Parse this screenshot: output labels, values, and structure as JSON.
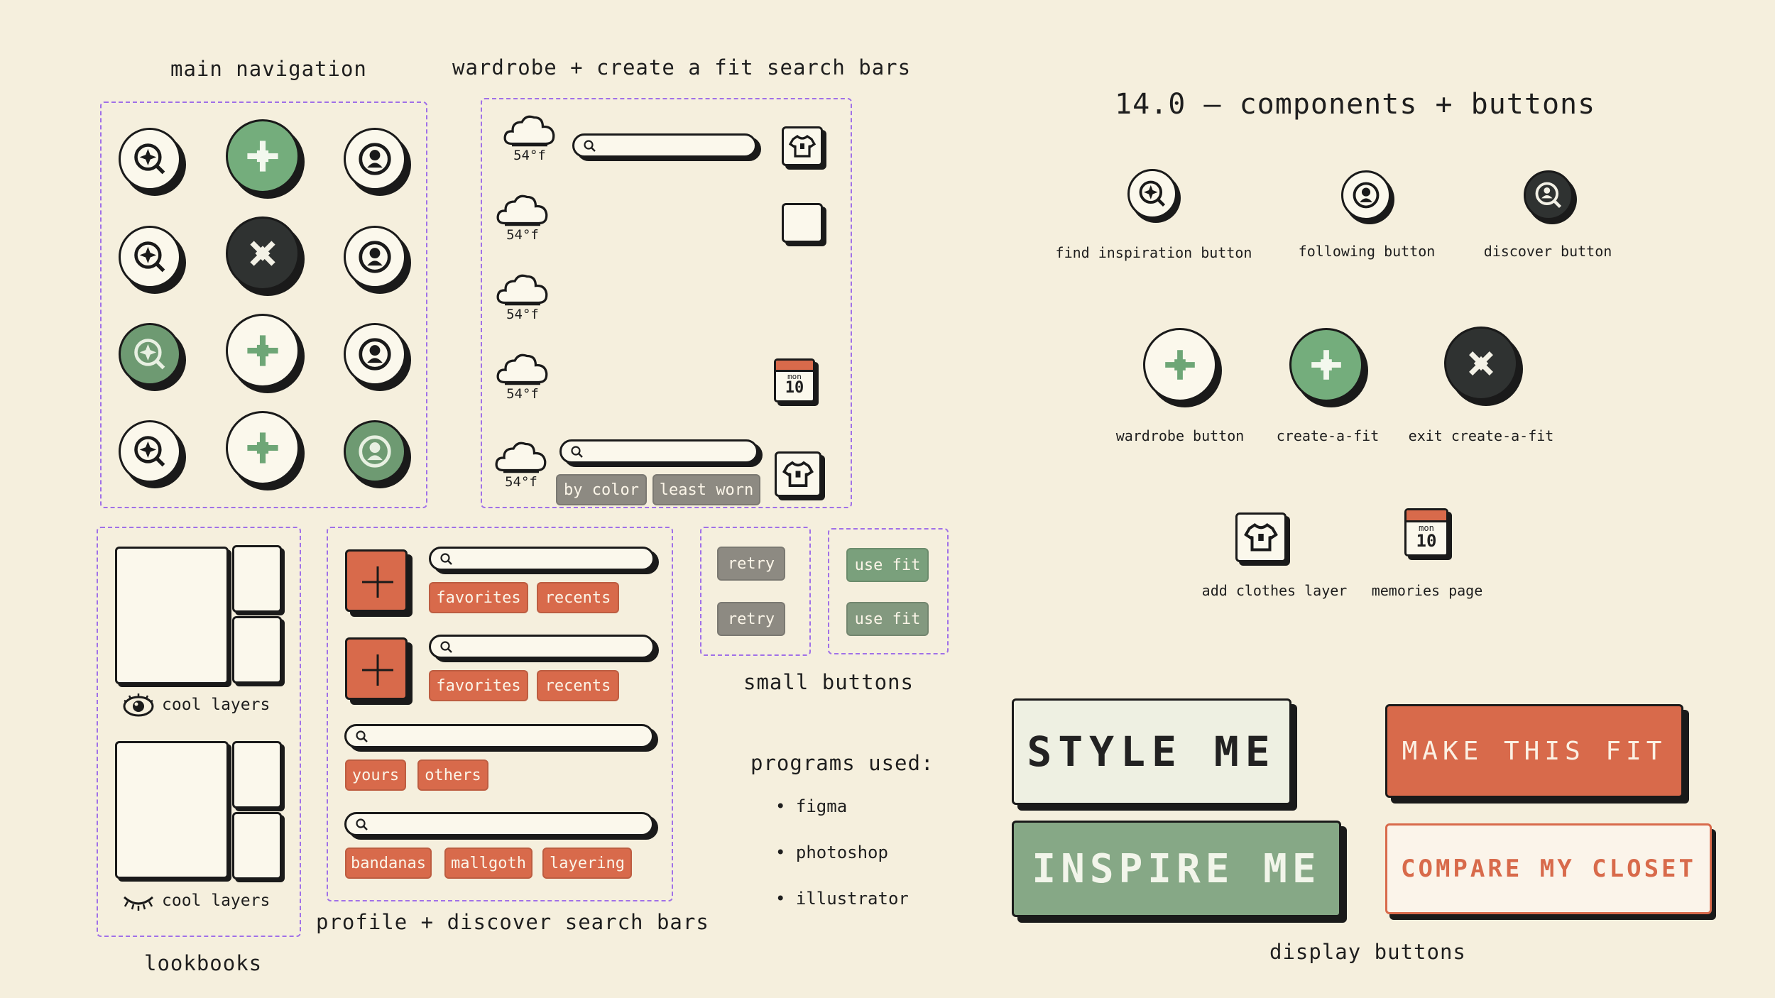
{
  "headings": {
    "main_nav": "main navigation",
    "search_bars": "wardrobe + create a fit search bars",
    "page_title": "14.0 – components + buttons",
    "lookbooks": "lookbooks",
    "profile_discover": "profile + discover search bars",
    "small_buttons": "small buttons",
    "programs": "programs used:",
    "display_buttons": "display buttons"
  },
  "weather": {
    "temp": "54°f"
  },
  "chips": {
    "by_color": "by color",
    "least_worn": "least worn",
    "favorites": "favorites",
    "recents": "recents",
    "yours": "yours",
    "others": "others",
    "bandanas": "bandanas",
    "mallgoth": "mallgoth",
    "layering": "layering"
  },
  "small": {
    "retry": "retry",
    "use_fit": "use fit"
  },
  "lookbook": {
    "label": "cool layers"
  },
  "calendar": {
    "day": "mon",
    "date": "10"
  },
  "components": {
    "find_inspiration": "find inspiration button",
    "following": "following button",
    "discover": "discover button",
    "wardrobe": "wardrobe button",
    "create_a_fit": "create-a-fit",
    "exit_create": "exit create-a-fit",
    "add_clothes": "add clothes layer",
    "memories": "memories page"
  },
  "programs": [
    "figma",
    "photoshop",
    "illustrator"
  ],
  "display": {
    "style_me": "STYLE ME",
    "make_this_fit": "MAKE THIS FIT",
    "inspire_me": "INSPIRE ME",
    "compare": "COMPARE MY CLOSET"
  },
  "colors": {
    "background": "#f5efdd",
    "cream": "#fbf8ec",
    "green": "#74ad7c",
    "sage": "#6e9a72",
    "dark": "#2f3231",
    "orange": "#d86a4b",
    "grey_chip": "#8d8a82",
    "dashed_border": "#a070e8"
  }
}
